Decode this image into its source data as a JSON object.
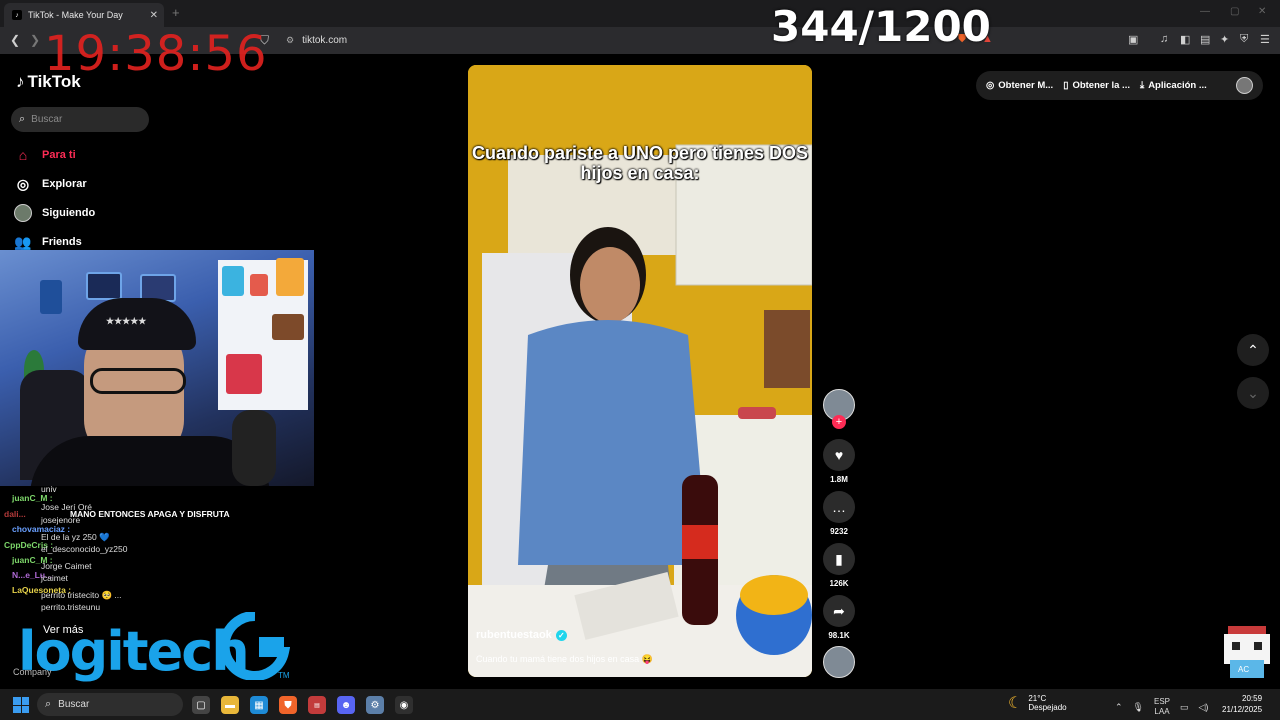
{
  "browser": {
    "tab_title": "TikTok - Make Your Day",
    "tab_close": "✕",
    "new_tab": "+",
    "url": "tiktok.com"
  },
  "overlays": {
    "clock": "19:38:56",
    "counter": "344/1200"
  },
  "sidebar": {
    "logo": "TikTok",
    "search_placeholder": "Buscar",
    "items": [
      {
        "label": "Para ti",
        "icon": "home-icon",
        "active": true
      },
      {
        "label": "Explorar",
        "icon": "compass-icon"
      },
      {
        "label": "Siguiendo",
        "icon": "avatar-icon"
      },
      {
        "label": "Friends",
        "icon": "friends-icon"
      }
    ],
    "accent_color": "#fe2c55"
  },
  "chat": [
    {
      "name": "",
      "text": "univ"
    },
    {
      "name": "juanC_M :",
      "text": ""
    },
    {
      "name": "",
      "text": "Jose Jerí Oré"
    },
    {
      "name": "dali...",
      "text": "MANO ENTONCES APAGA Y DISFRUTA"
    },
    {
      "name": "",
      "text": "josejenore"
    },
    {
      "name": "chovamaciaz :",
      "text": ""
    },
    {
      "name": "",
      "text": "El de la yz 250 💙"
    },
    {
      "name": "CppDeCris :",
      "text": ""
    },
    {
      "name": "",
      "text": "el_desconocido_yz250"
    },
    {
      "name": "juanC_M :",
      "text": ""
    },
    {
      "name": "",
      "text": "Jorge Caimet"
    },
    {
      "name": "N...e_Lu...",
      "text": ""
    },
    {
      "name": "",
      "text": "jcaimet"
    },
    {
      "name": "LaQuesoneta :",
      "text": ""
    },
    {
      "name": "",
      "text": "perrito tristecito 🥺 ..."
    },
    {
      "name": "",
      "text": "perrito.tristeunu"
    }
  ],
  "sponsor": {
    "ver_mas": "Ver más",
    "brand": "logitech",
    "company": "Company"
  },
  "video": {
    "caption": "Cuando pariste a UNO pero tienes DOS hijos en casa:",
    "username": "rubentuestaok",
    "description": "Cuando tu mamá tiene dos hijos en casa 😝"
  },
  "actions": {
    "likes": "1.8M",
    "comments": "9232",
    "saves": "126K",
    "shares": "98.1K"
  },
  "top_buttons": {
    "obtain_m": "Obtener M...",
    "obtain_la": "Obtener la ...",
    "app": "Aplicación ..."
  },
  "taskbar": {
    "search": "Buscar",
    "temperature": "21°C",
    "weather": "Despejado",
    "lang1": "ESP",
    "lang2": "LAA",
    "time": "20:59",
    "date": "21/12/2025"
  }
}
